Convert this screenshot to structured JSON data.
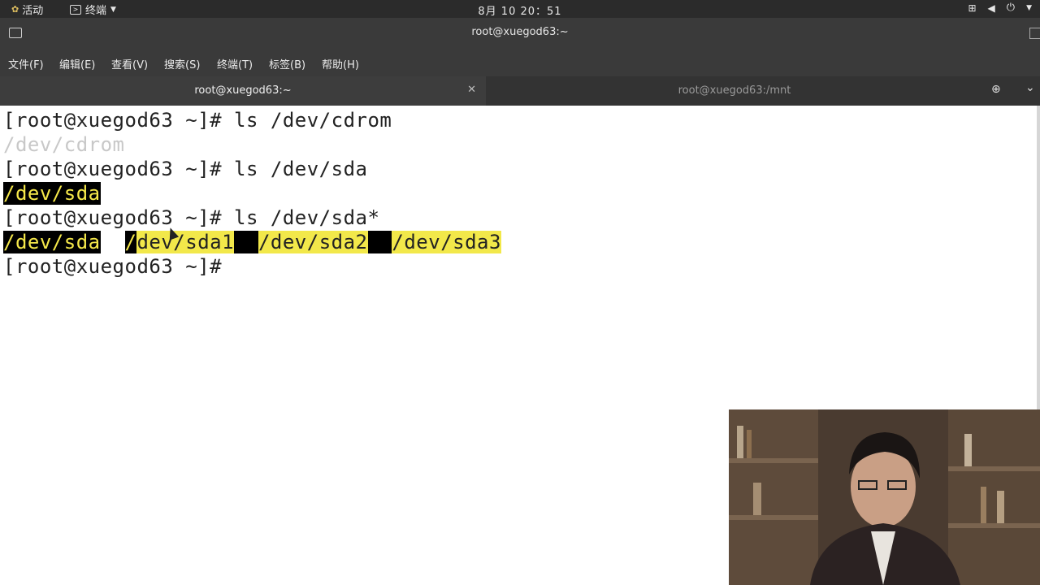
{
  "topbar": {
    "activities": "活动",
    "app_menu": "终端",
    "clock": "8月 10  20：51"
  },
  "window": {
    "title": "root@xuegod63:~"
  },
  "menubar": {
    "items": [
      "文件(F)",
      "编辑(E)",
      "查看(V)",
      "搜索(S)",
      "终端(T)",
      "标签(B)",
      "帮助(H)"
    ]
  },
  "tabs": [
    {
      "label": "root@xuegod63:~",
      "active": true
    },
    {
      "label": "root@xuegod63:/mnt",
      "active": false
    }
  ],
  "terminal": {
    "lines": {
      "l1": "[root@xuegod63 ~]# ls /dev/cdrom",
      "l2": "/dev/cdrom",
      "l3": "[root@xuegod63 ~]# ls /dev/sda",
      "l4": "/dev/sda",
      "l5": "[root@xuegod63 ~]# ls /dev/sda*",
      "l6a": "/dev/sda",
      "l6b": "/",
      "l6c": "dev/sda1",
      "l6d": "/dev/sda2",
      "l6e": "/dev/sda3",
      "l7": "[root@xuegod63 ~]#"
    }
  },
  "colors": {
    "highlight_yellow": "#f5e84a",
    "terminal_bg": "#ffffff",
    "chrome_bg": "#3a3a3a"
  }
}
